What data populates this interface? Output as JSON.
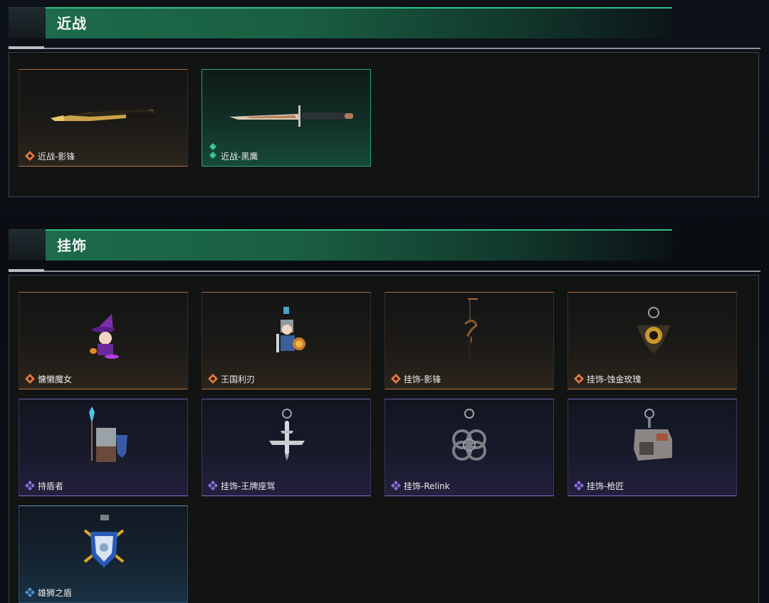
{
  "sections": {
    "melee": {
      "title": "近战",
      "items": [
        {
          "label": "近战-影锋",
          "rarity": "orange"
        },
        {
          "label": "近战-黑鹰",
          "rarity": "green"
        }
      ]
    },
    "charms": {
      "title": "挂饰",
      "items": [
        {
          "label": "慵懒魔女",
          "rarity": "orange"
        },
        {
          "label": "王国利刃",
          "rarity": "orange"
        },
        {
          "label": "挂饰-影锋",
          "rarity": "orange"
        },
        {
          "label": "挂饰-蚀金玫瑰",
          "rarity": "orange"
        },
        {
          "label": "持盾者",
          "rarity": "purple"
        },
        {
          "label": "挂饰-王牌座驾",
          "rarity": "purple"
        },
        {
          "label": "挂饰-Relink",
          "rarity": "purple"
        },
        {
          "label": "挂饰-枪匠",
          "rarity": "purple"
        },
        {
          "label": "雄狮之盾",
          "rarity": "blue"
        }
      ]
    }
  },
  "colors": {
    "orange": "#e07a3c",
    "green": "#36c98d",
    "purple": "#8b6fe0",
    "blue": "#4a90d6",
    "header_band": "#1d6a4c"
  },
  "icons": {
    "orange": "diamond-rarity-icon",
    "green": "double-diamond-rarity-icon",
    "purple": "four-diamond-rarity-icon",
    "blue": "four-diamond-rarity-icon"
  }
}
